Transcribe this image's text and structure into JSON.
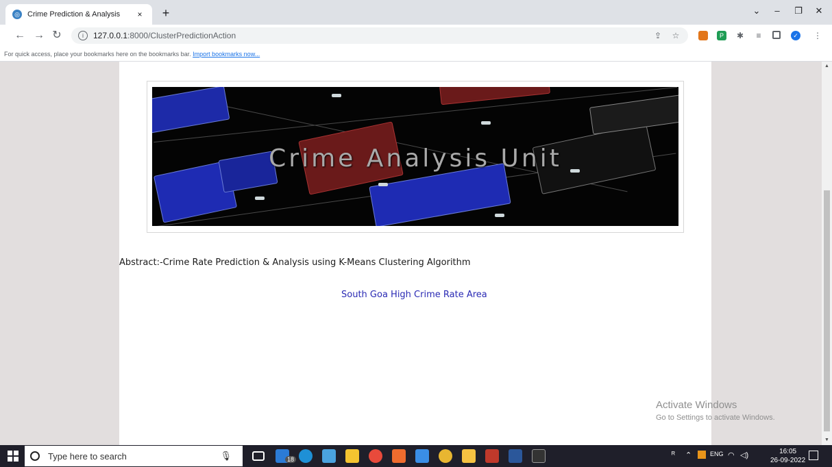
{
  "browser": {
    "tab_title": "Crime Prediction & Analysis",
    "tab_close": "×",
    "new_tab": "+",
    "url_host": "127.0.0.1",
    "url_path": ":8000/ClusterPredictionAction",
    "window_controls": [
      "⌄",
      "–",
      "❐",
      "✕"
    ]
  },
  "bookmarks_bar": {
    "text": "For quick access, place your bookmarks here on the bookmarks bar.",
    "link": "Import bookmarks now..."
  },
  "page": {
    "banner_title": "Crime Analysis Unit",
    "abstract": "Abstract:-Crime Rate Prediction & Analysis using K-Means Clustering Algorithm",
    "subtitle": "South Goa High Crime Rate Area"
  },
  "watermark": {
    "line1": "Activate Windows",
    "line2": "Go to Settings to activate Windows."
  },
  "taskbar": {
    "search_placeholder": "Type here to search",
    "mail_badge": "18",
    "time": "16:05",
    "date": "26-09-2022",
    "language": "ENG"
  },
  "colors": {
    "page_bg": "#e2dede",
    "link_blue": "#2a2ab4",
    "taskbar": "#1f1f2a"
  }
}
